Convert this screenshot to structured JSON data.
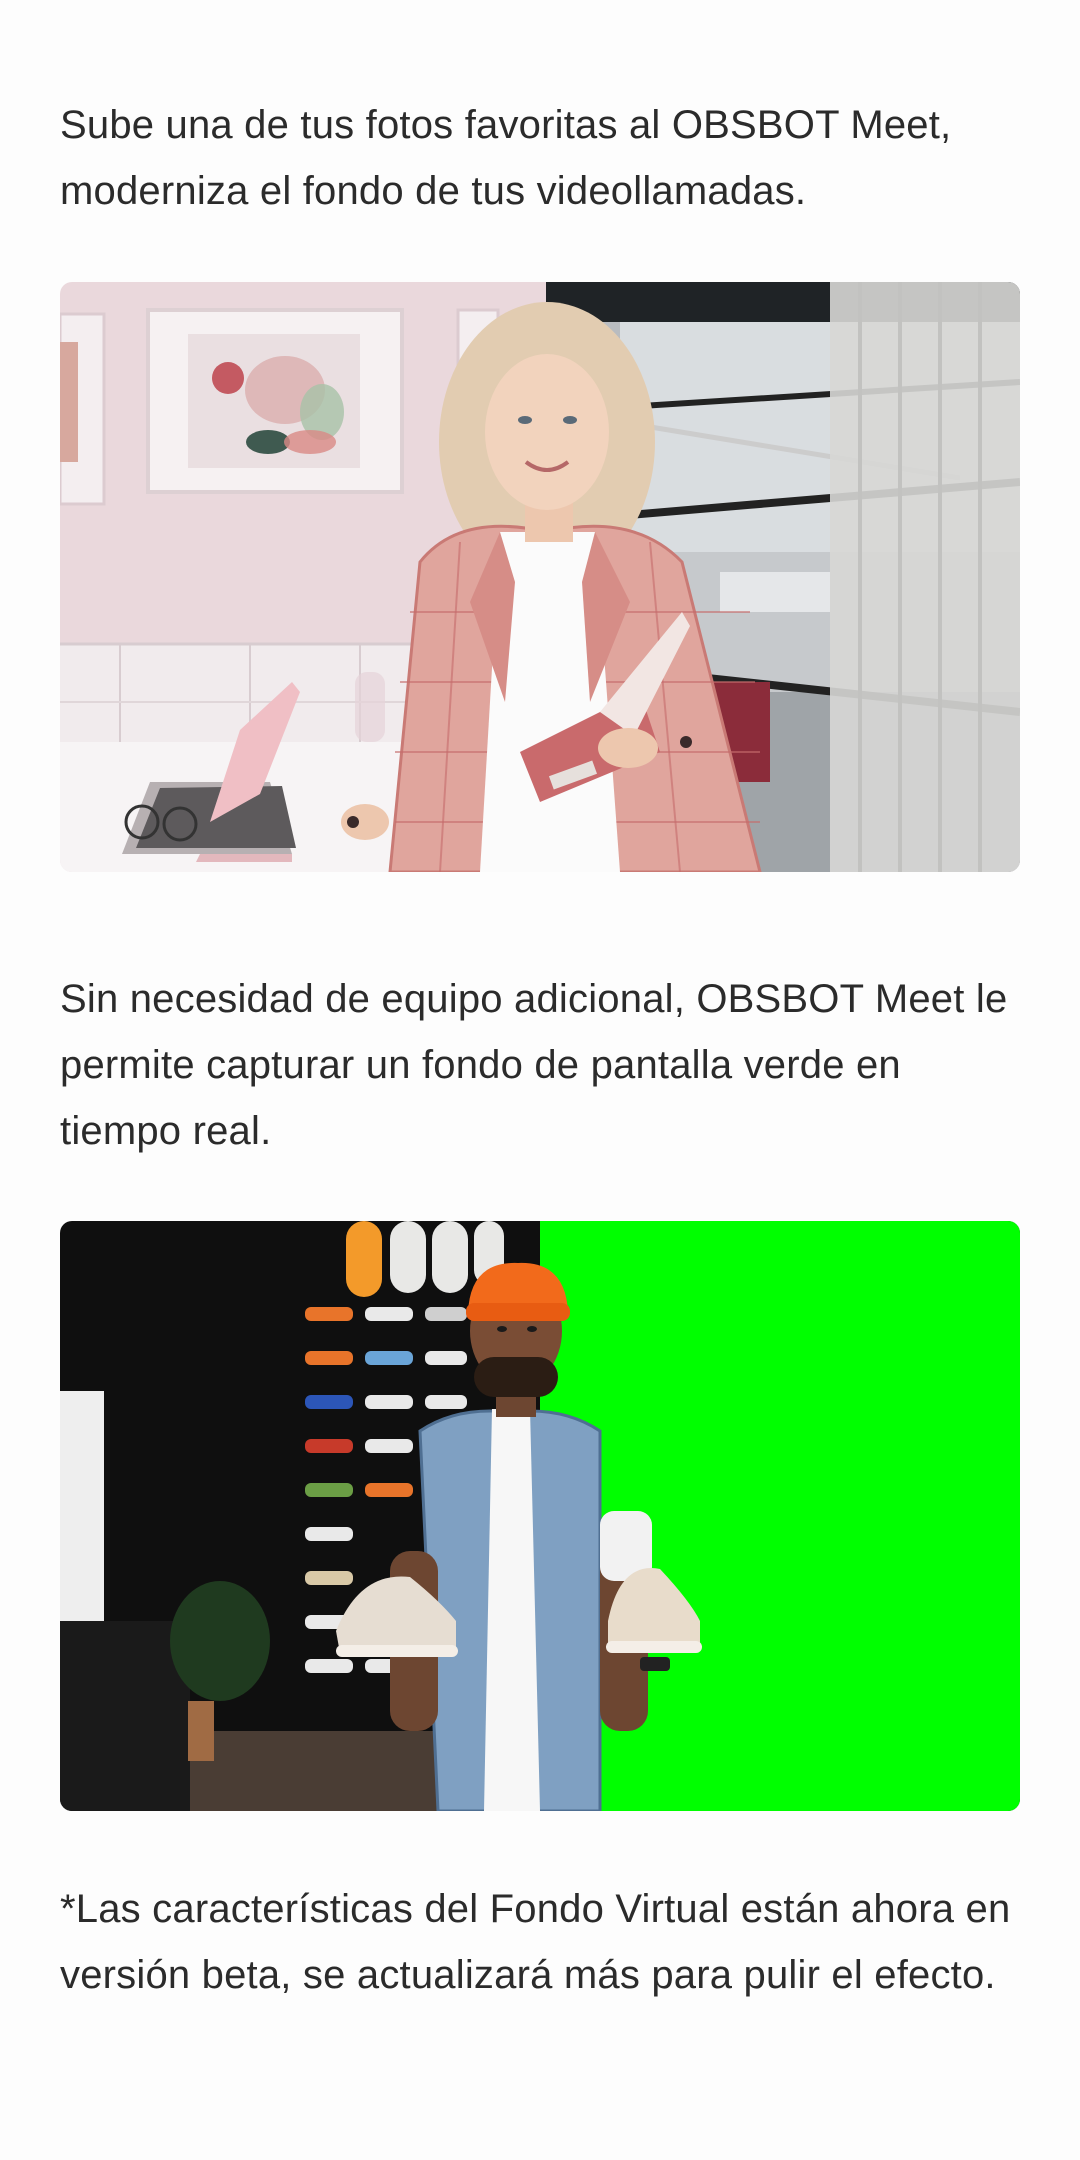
{
  "content": {
    "intro_text": "Sube una de tus fotos favoritas al OBSBOT Meet, moderniza el fondo de tus videollamadas.",
    "green_screen_text": "Sin necesidad de equipo adicional, OBSBOT Meet le permite capturar un fondo de pantalla verde en tiempo real.",
    "beta_note": "*Las características del Fondo Virtual están ahora en versión beta, se actualizará más para pulir el efecto."
  },
  "colors": {
    "text": "#2b2b2b",
    "background": "#fdfdfd",
    "chroma_green": "#00ff00"
  }
}
